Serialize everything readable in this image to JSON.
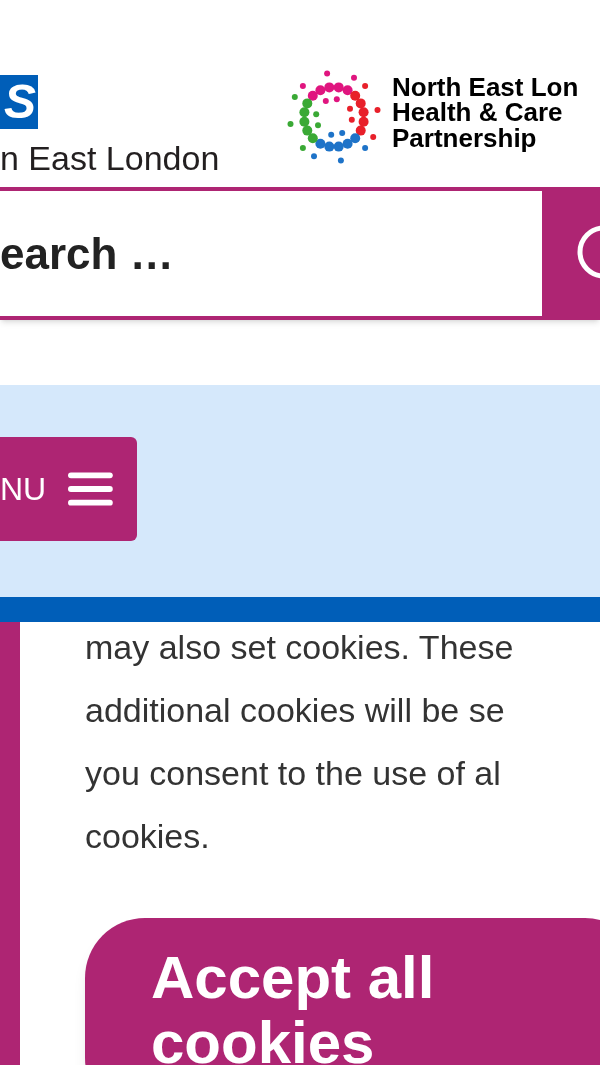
{
  "header": {
    "nhs_logo": {
      "letter": "S",
      "org": "n East London"
    },
    "partner_logo": {
      "lines": [
        "North East Lon",
        "Health & Care",
        "Partnership"
      ]
    }
  },
  "search": {
    "placeholder": "earch …"
  },
  "menu_button": {
    "label": "NU"
  },
  "cookie_text": {
    "lines": [
      "may also set cookies. These",
      "additional cookies will be se",
      "you consent to the use of al",
      "cookies."
    ]
  },
  "accept_button": {
    "lines": [
      "Accept all",
      "cookies"
    ]
  }
}
